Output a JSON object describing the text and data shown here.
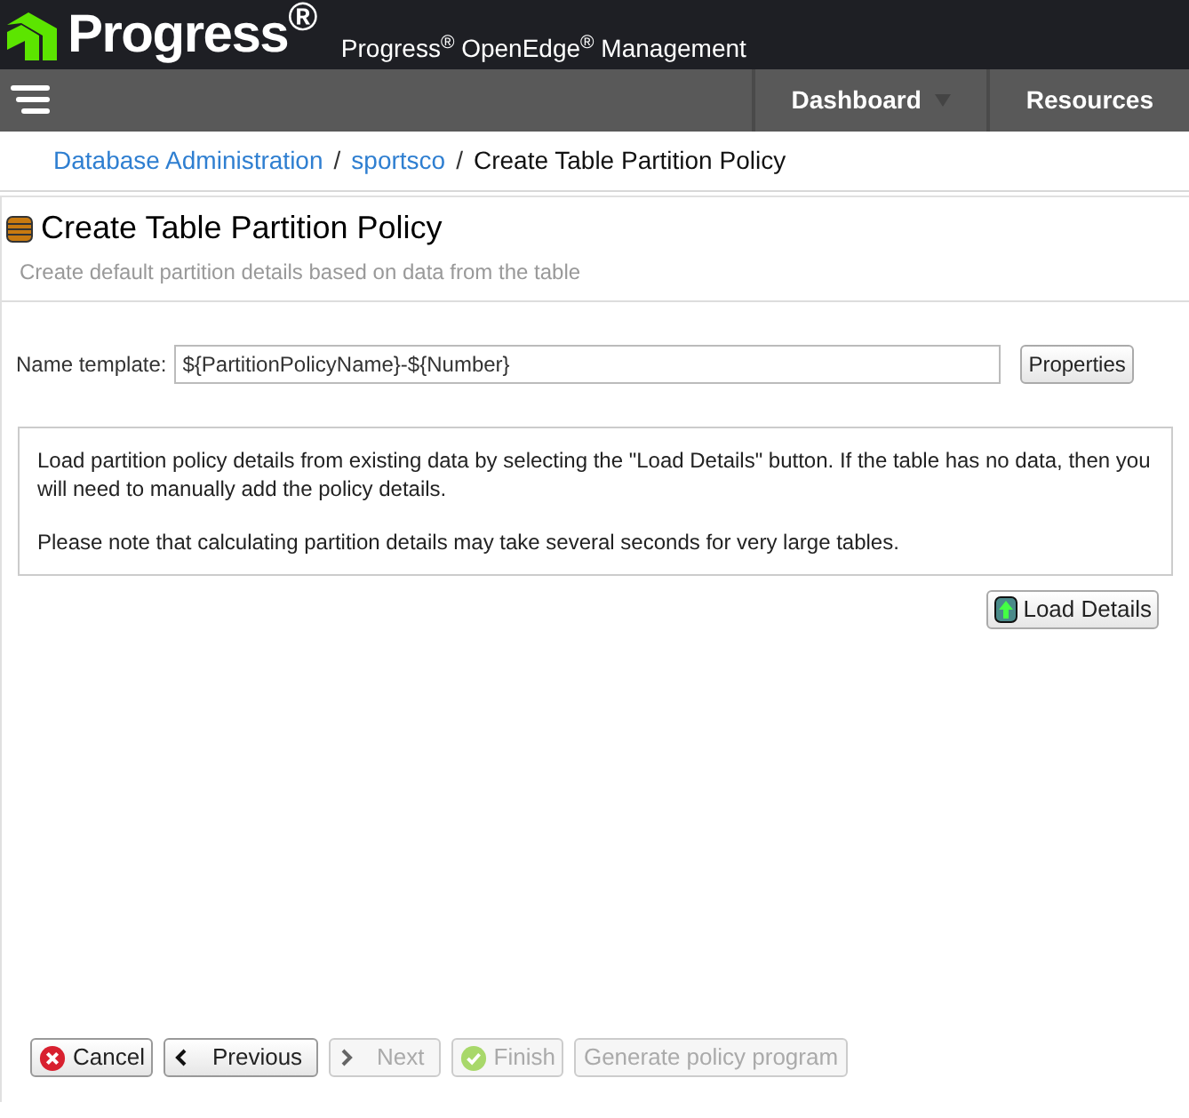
{
  "header": {
    "logo_text": "Progress$^{®}$",
    "product_title": "Progress$^{®}$ OpenEdge$^{®}$ Management"
  },
  "nav": [
    {
      "label": "Dashboard",
      "has_dropdown": true
    },
    {
      "label": "Resources",
      "has_dropdown": false
    }
  ],
  "breadcrumb": [
    {
      "label": "Database Administration",
      "kind": "link",
      "separator": "/"
    },
    {
      "label": "sportsco",
      "kind": "link",
      "separator": "/"
    },
    {
      "label": "Create Table Partition Policy",
      "kind": "current"
    }
  ],
  "panel": {
    "title": "Create Table Partition Policy",
    "subtitle": "Create default partition details based on data from the table"
  },
  "name_template": {
    "label": "Name template:",
    "value": "${PartitionPolicyName}-${Number}",
    "button": "Properties"
  },
  "info": [
    "Load partition policy details from existing data by selecting the \"Load Details\" button. If the table has no data, then you will need to manually add the policy details.",
    "Please note that calculating partition details may take several seconds for very large tables."
  ],
  "load_button": "Load Details",
  "buttons": [
    {
      "label": "Cancel",
      "kind": "cancel",
      "disabled": false
    },
    {
      "label": "Previous",
      "kind": "previous",
      "disabled": false
    },
    {
      "label": "Next",
      "kind": "next",
      "disabled": true
    },
    {
      "label": "Finish",
      "kind": "finish",
      "disabled": true
    },
    {
      "label": "Generate policy program",
      "kind": "plain",
      "disabled": true
    }
  ]
}
